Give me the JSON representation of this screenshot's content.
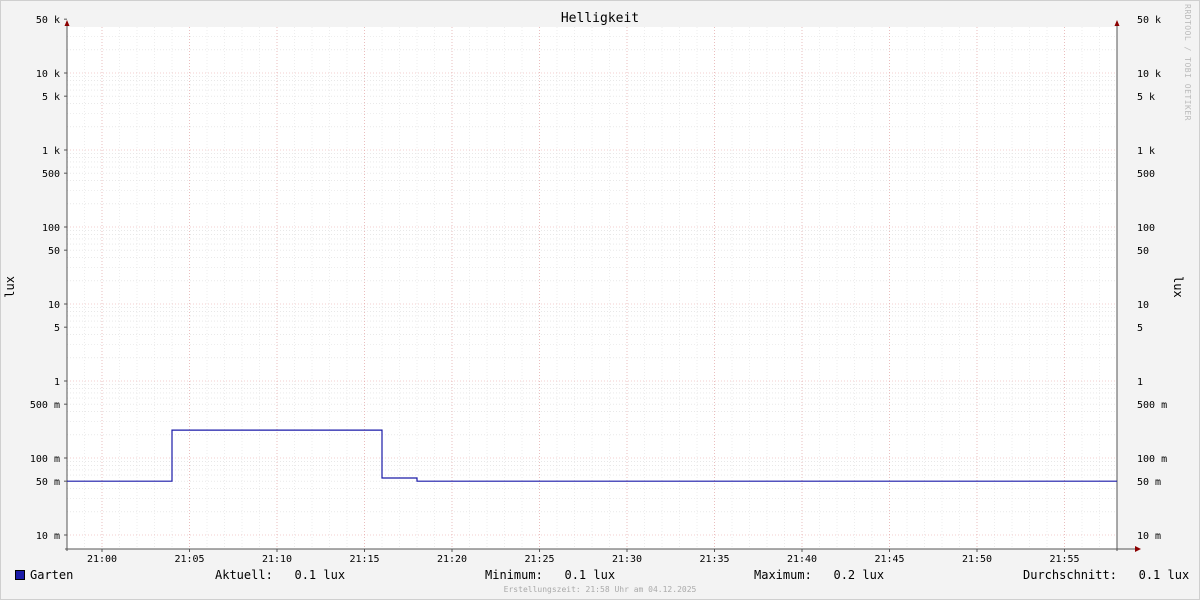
{
  "chart_data": {
    "type": "line",
    "title": "Helligkeit",
    "ylabel": "lux",
    "yscale": "log",
    "ylim": [
      0.01,
      60000
    ],
    "xlim": [
      "20:58",
      "21:58"
    ],
    "y_ticks": [
      {
        "value": 0.01,
        "label": "10 m"
      },
      {
        "value": 0.05,
        "label": "50 m"
      },
      {
        "value": 0.1,
        "label": "100 m"
      },
      {
        "value": 0.5,
        "label": "500 m"
      },
      {
        "value": 1,
        "label": "1"
      },
      {
        "value": 5,
        "label": "5"
      },
      {
        "value": 10,
        "label": "10"
      },
      {
        "value": 50,
        "label": "50"
      },
      {
        "value": 100,
        "label": "100"
      },
      {
        "value": 500,
        "label": "500"
      },
      {
        "value": 1000,
        "label": "1 k"
      },
      {
        "value": 5000,
        "label": "5 k"
      },
      {
        "value": 10000,
        "label": "10 k"
      },
      {
        "value": 50000,
        "label": "50 k"
      }
    ],
    "x_ticks": [
      "21:00",
      "21:05",
      "21:10",
      "21:15",
      "21:20",
      "21:25",
      "21:30",
      "21:35",
      "21:40",
      "21:45",
      "21:50",
      "21:55"
    ],
    "grid": true,
    "series": [
      {
        "name": "Garten",
        "color": "#1a1aa8",
        "points": [
          [
            "20:58",
            0.05
          ],
          [
            "21:04",
            0.05
          ],
          [
            "21:04",
            0.23
          ],
          [
            "21:16",
            0.23
          ],
          [
            "21:16",
            0.055
          ],
          [
            "21:18",
            0.055
          ],
          [
            "21:18",
            0.05
          ],
          [
            "21:58",
            0.05
          ]
        ]
      }
    ]
  },
  "watermark": "RRDTOOL / TOBI OETIKER",
  "legend": {
    "series_name": "Garten",
    "aktuell": "Aktuell:   0.1 lux",
    "minimum": "Minimum:   0.1 lux",
    "maximum": "Maximum:   0.2 lux",
    "durchschnitt": "Durchschnitt:   0.1 lux"
  },
  "footer": "Erstellungszeit: 21:58 Uhr am 04.12.2025"
}
